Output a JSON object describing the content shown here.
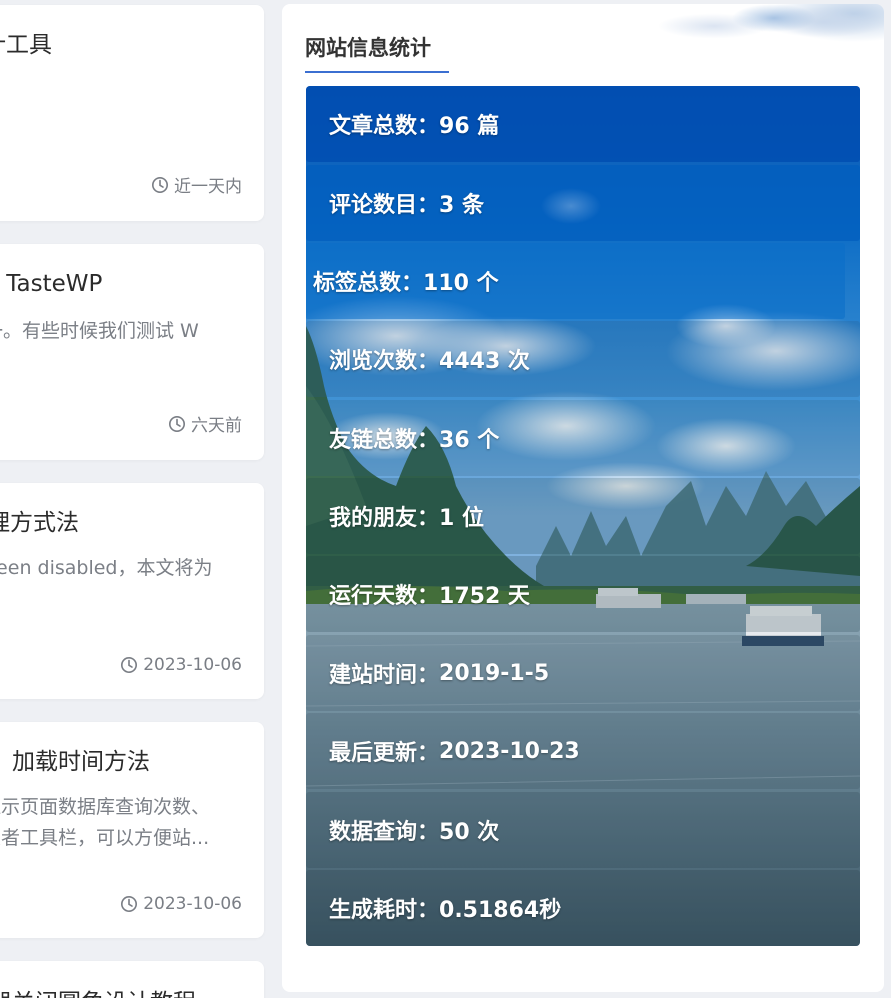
{
  "posts": [
    {
      "title": "统计工具",
      "excerpt": [],
      "time": "近一天内"
    },
    {
      "title": "试 TasteWP",
      "excerpt": [
        "一。有些时候我们测试 W"
      ],
      "time": "六天前"
    },
    {
      "title": "处理方式法",
      "excerpt": [
        "been disabled，本文将为"
      ],
      "time": "2023-10-06"
    },
    {
      "title": "加载时间方法",
      "excerpt": [
        "显示页面数据库查询次数、",
        "发者工具栏，可以方便站..."
      ],
      "time": "2023-10-06"
    },
    {
      "title": "览器关闭圆角设计教程",
      "excerpt": [],
      "time": ""
    }
  ],
  "widget": {
    "title": "网站信息统计",
    "stats": [
      {
        "label": "文章总数：",
        "value": "96 篇"
      },
      {
        "label": "评论数目：",
        "value": "3 条"
      },
      {
        "label": "标签总数：",
        "value": "110 个"
      },
      {
        "label": "浏览次数：",
        "value": "4443 次"
      },
      {
        "label": "友链总数：",
        "value": "36 个"
      },
      {
        "label": "我的朋友：",
        "value": "1 位"
      },
      {
        "label": "运行天数：",
        "value": "1752 天"
      },
      {
        "label": "建站时间：",
        "value": "2019-1-5"
      },
      {
        "label": "最后更新：",
        "value": "2023-10-23"
      },
      {
        "label": "数据查询：",
        "value": "50 次"
      },
      {
        "label": "生成耗时：",
        "value": "0.51864秒"
      }
    ]
  },
  "colors": {
    "accent": "#3b6fd1",
    "page_bg": "#eef0f4",
    "card_bg": "#ffffff"
  }
}
